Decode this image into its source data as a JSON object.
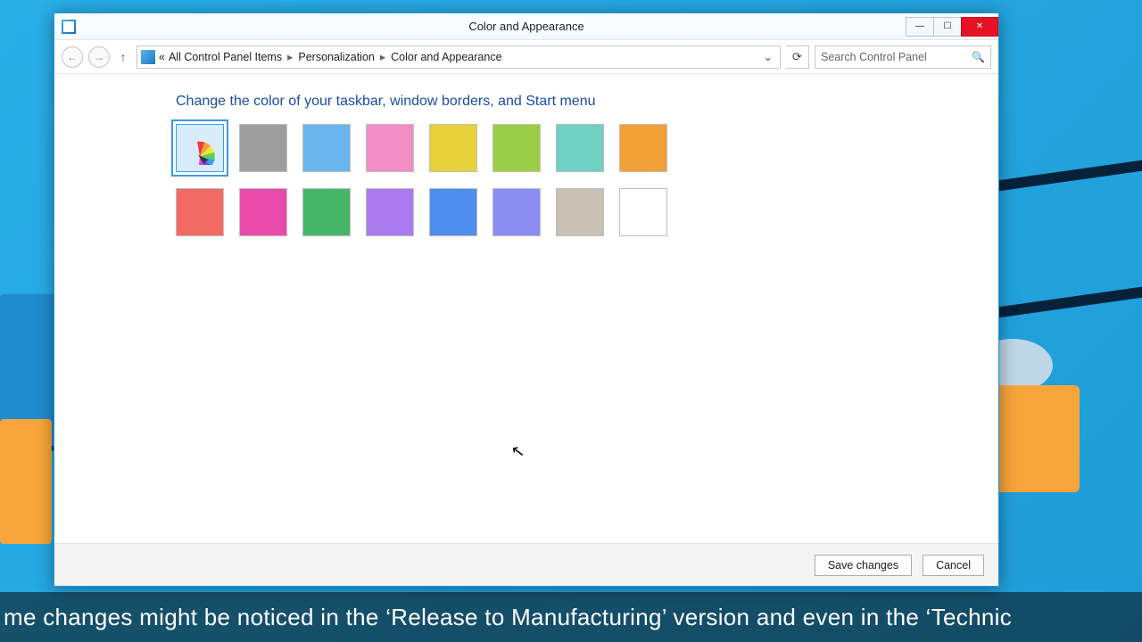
{
  "window": {
    "title": "Color and Appearance",
    "breadcrumb": {
      "prefix": "«",
      "items": [
        "All Control Panel Items",
        "Personalization",
        "Color and Appearance"
      ]
    },
    "search_placeholder": "Search Control Panel",
    "heading": "Change the color of your taskbar, window borders, and Start menu",
    "buttons": {
      "save": "Save changes",
      "cancel": "Cancel"
    }
  },
  "swatches": {
    "selected_index": 0,
    "row1": [
      "automatic",
      "#9e9e9e",
      "#6bb6ee",
      "#f18cc4",
      "#e8d23a",
      "#9bce46",
      "#6fcfc2",
      "#f2a038"
    ],
    "row2": [
      "#f26a63",
      "#e84aa9",
      "#46b668",
      "#ac7af0",
      "#4f8def",
      "#8b8df2",
      "#c9c1b4",
      "#ffffff"
    ]
  },
  "subtitle": "me changes might be noticed in the ‘Release to Manufacturing’ version and even in the ‘Technic"
}
